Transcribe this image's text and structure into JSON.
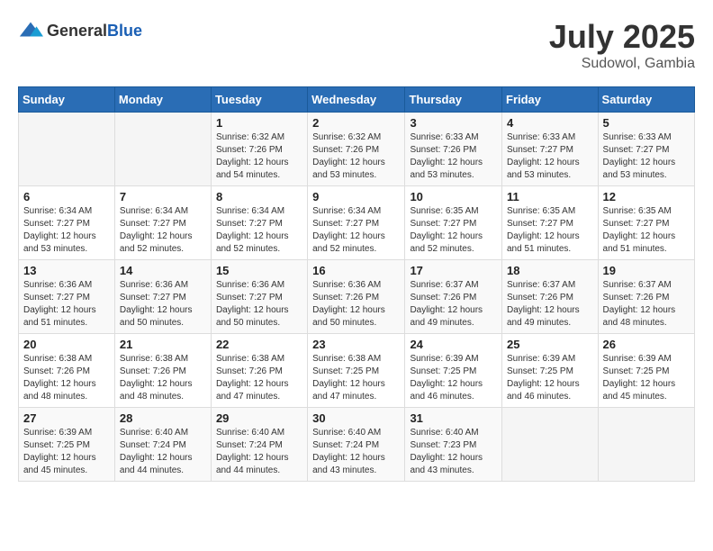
{
  "logo": {
    "general": "General",
    "blue": "Blue"
  },
  "header": {
    "month": "July 2025",
    "location": "Sudowol, Gambia"
  },
  "weekdays": [
    "Sunday",
    "Monday",
    "Tuesday",
    "Wednesday",
    "Thursday",
    "Friday",
    "Saturday"
  ],
  "weeks": [
    [
      {
        "day": "",
        "sunrise": "",
        "sunset": "",
        "daylight": ""
      },
      {
        "day": "",
        "sunrise": "",
        "sunset": "",
        "daylight": ""
      },
      {
        "day": "1",
        "sunrise": "Sunrise: 6:32 AM",
        "sunset": "Sunset: 7:26 PM",
        "daylight": "Daylight: 12 hours and 54 minutes."
      },
      {
        "day": "2",
        "sunrise": "Sunrise: 6:32 AM",
        "sunset": "Sunset: 7:26 PM",
        "daylight": "Daylight: 12 hours and 53 minutes."
      },
      {
        "day": "3",
        "sunrise": "Sunrise: 6:33 AM",
        "sunset": "Sunset: 7:26 PM",
        "daylight": "Daylight: 12 hours and 53 minutes."
      },
      {
        "day": "4",
        "sunrise": "Sunrise: 6:33 AM",
        "sunset": "Sunset: 7:27 PM",
        "daylight": "Daylight: 12 hours and 53 minutes."
      },
      {
        "day": "5",
        "sunrise": "Sunrise: 6:33 AM",
        "sunset": "Sunset: 7:27 PM",
        "daylight": "Daylight: 12 hours and 53 minutes."
      }
    ],
    [
      {
        "day": "6",
        "sunrise": "Sunrise: 6:34 AM",
        "sunset": "Sunset: 7:27 PM",
        "daylight": "Daylight: 12 hours and 53 minutes."
      },
      {
        "day": "7",
        "sunrise": "Sunrise: 6:34 AM",
        "sunset": "Sunset: 7:27 PM",
        "daylight": "Daylight: 12 hours and 52 minutes."
      },
      {
        "day": "8",
        "sunrise": "Sunrise: 6:34 AM",
        "sunset": "Sunset: 7:27 PM",
        "daylight": "Daylight: 12 hours and 52 minutes."
      },
      {
        "day": "9",
        "sunrise": "Sunrise: 6:34 AM",
        "sunset": "Sunset: 7:27 PM",
        "daylight": "Daylight: 12 hours and 52 minutes."
      },
      {
        "day": "10",
        "sunrise": "Sunrise: 6:35 AM",
        "sunset": "Sunset: 7:27 PM",
        "daylight": "Daylight: 12 hours and 52 minutes."
      },
      {
        "day": "11",
        "sunrise": "Sunrise: 6:35 AM",
        "sunset": "Sunset: 7:27 PM",
        "daylight": "Daylight: 12 hours and 51 minutes."
      },
      {
        "day": "12",
        "sunrise": "Sunrise: 6:35 AM",
        "sunset": "Sunset: 7:27 PM",
        "daylight": "Daylight: 12 hours and 51 minutes."
      }
    ],
    [
      {
        "day": "13",
        "sunrise": "Sunrise: 6:36 AM",
        "sunset": "Sunset: 7:27 PM",
        "daylight": "Daylight: 12 hours and 51 minutes."
      },
      {
        "day": "14",
        "sunrise": "Sunrise: 6:36 AM",
        "sunset": "Sunset: 7:27 PM",
        "daylight": "Daylight: 12 hours and 50 minutes."
      },
      {
        "day": "15",
        "sunrise": "Sunrise: 6:36 AM",
        "sunset": "Sunset: 7:27 PM",
        "daylight": "Daylight: 12 hours and 50 minutes."
      },
      {
        "day": "16",
        "sunrise": "Sunrise: 6:36 AM",
        "sunset": "Sunset: 7:26 PM",
        "daylight": "Daylight: 12 hours and 50 minutes."
      },
      {
        "day": "17",
        "sunrise": "Sunrise: 6:37 AM",
        "sunset": "Sunset: 7:26 PM",
        "daylight": "Daylight: 12 hours and 49 minutes."
      },
      {
        "day": "18",
        "sunrise": "Sunrise: 6:37 AM",
        "sunset": "Sunset: 7:26 PM",
        "daylight": "Daylight: 12 hours and 49 minutes."
      },
      {
        "day": "19",
        "sunrise": "Sunrise: 6:37 AM",
        "sunset": "Sunset: 7:26 PM",
        "daylight": "Daylight: 12 hours and 48 minutes."
      }
    ],
    [
      {
        "day": "20",
        "sunrise": "Sunrise: 6:38 AM",
        "sunset": "Sunset: 7:26 PM",
        "daylight": "Daylight: 12 hours and 48 minutes."
      },
      {
        "day": "21",
        "sunrise": "Sunrise: 6:38 AM",
        "sunset": "Sunset: 7:26 PM",
        "daylight": "Daylight: 12 hours and 48 minutes."
      },
      {
        "day": "22",
        "sunrise": "Sunrise: 6:38 AM",
        "sunset": "Sunset: 7:26 PM",
        "daylight": "Daylight: 12 hours and 47 minutes."
      },
      {
        "day": "23",
        "sunrise": "Sunrise: 6:38 AM",
        "sunset": "Sunset: 7:25 PM",
        "daylight": "Daylight: 12 hours and 47 minutes."
      },
      {
        "day": "24",
        "sunrise": "Sunrise: 6:39 AM",
        "sunset": "Sunset: 7:25 PM",
        "daylight": "Daylight: 12 hours and 46 minutes."
      },
      {
        "day": "25",
        "sunrise": "Sunrise: 6:39 AM",
        "sunset": "Sunset: 7:25 PM",
        "daylight": "Daylight: 12 hours and 46 minutes."
      },
      {
        "day": "26",
        "sunrise": "Sunrise: 6:39 AM",
        "sunset": "Sunset: 7:25 PM",
        "daylight": "Daylight: 12 hours and 45 minutes."
      }
    ],
    [
      {
        "day": "27",
        "sunrise": "Sunrise: 6:39 AM",
        "sunset": "Sunset: 7:25 PM",
        "daylight": "Daylight: 12 hours and 45 minutes."
      },
      {
        "day": "28",
        "sunrise": "Sunrise: 6:40 AM",
        "sunset": "Sunset: 7:24 PM",
        "daylight": "Daylight: 12 hours and 44 minutes."
      },
      {
        "day": "29",
        "sunrise": "Sunrise: 6:40 AM",
        "sunset": "Sunset: 7:24 PM",
        "daylight": "Daylight: 12 hours and 44 minutes."
      },
      {
        "day": "30",
        "sunrise": "Sunrise: 6:40 AM",
        "sunset": "Sunset: 7:24 PM",
        "daylight": "Daylight: 12 hours and 43 minutes."
      },
      {
        "day": "31",
        "sunrise": "Sunrise: 6:40 AM",
        "sunset": "Sunset: 7:23 PM",
        "daylight": "Daylight: 12 hours and 43 minutes."
      },
      {
        "day": "",
        "sunrise": "",
        "sunset": "",
        "daylight": ""
      },
      {
        "day": "",
        "sunrise": "",
        "sunset": "",
        "daylight": ""
      }
    ]
  ]
}
